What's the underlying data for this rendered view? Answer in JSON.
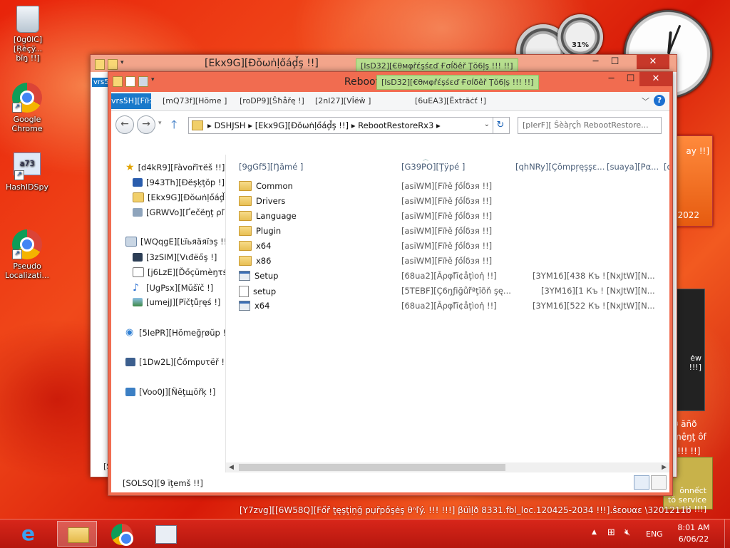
{
  "desktop": {
    "icons": [
      {
        "label": "[0g0lC][Ŗèçÿ..."
      },
      {
        "label": "bĭŋ !!]"
      },
      {
        "label": "Google\nChrome"
      },
      {
        "label": "HashIDSpy"
      },
      {
        "label": "Pseudo\nLocalizati..."
      }
    ],
    "gauge_text": "31%",
    "calendar_text": "ay !!]",
    "calendar_year": "2022",
    "feed_text": "ėw\n!!!]",
    "bg_text_1": "ø ăñð",
    "bg_text_2": "mệŋţ ôf",
    "bg_text_3": "!!! !!]",
    "notification_text": "ŏnnếct\ntŏ service !!! !!!]",
    "watermark": "[Y7zvg][[6W58Q][Főř ţęşţiņğ pџřpőşėş θⁿľý. !!! !!!] βüìļð 8331.fbl_loc.120425-2034 !!!].ŝεουαε \\3201211b"
  },
  "back_window": {
    "title": "[Ekx9G][Ðŏωṅḷőáḑ̌ş !!]",
    "left_tab_fragment": "vrs5",
    "status_fragment": "[S"
  },
  "tooltip_back": "[IsD32][€θмφřέşśεď Ғσĺδêř Ţŏ6ļş !!! !!]",
  "tooltip_front": "[IsD32][€θмφřέşśεď Ғσĺδêř Ţŏ6ļş !!! !!]",
  "window": {
    "title": "RebootRestoreRx3",
    "ribbon": {
      "file_tab": "vrs5H][Fïŀз",
      "tabs": [
        "[mQ73f][Hŏmе ]",
        "[roDP9][Ŝħåřę !]",
        "[2nI27][Vİёŵ ]",
        "[6uEA3][Ëхtrăċť !]"
      ]
    },
    "address": {
      "crumbs": [
        "DSHJSH",
        "[Ekx9G][Ðŏωṅḷőáḑ̌ş !!]",
        "RebootRestoreRx3"
      ]
    },
    "search_placeholder": "[pIerF][ Ŝèàŗçĥ RebootRestore...",
    "nav": {
      "favorites": "[d4kR9][Fàvоřĭτёš !!]",
      "desktop": "[943Th][Ðёşķţŏр !]",
      "downloads": "[Ekx9G][Ðŏωṅḷőáḑ̌ş",
      "recent": "[GRWVo][Ґеčёŋţ ρľ",
      "libraries": "[WQqgE][Ŀïьяäяïэş !!]",
      "videos": "[3zSIM][Vιđёőş !]",
      "documents": "[j6LzE][Ďőçŭmèŋτś !",
      "music": "[UgPsx][Mŭšïč !]",
      "pictures": "[umejJ][Pïčţůŗęś !]",
      "homegroup": "[5IePR][Hŏmеğŗøŭp !!]",
      "computer": "[1Dw2L][Ĉőmрυτёř !]",
      "network": "[Voo0J][Ňĕţщŏřķ !]"
    },
    "columns": [
      "[9gGf5][Ŋămé ]",
      "[G39PO][Ţÿрé ]",
      "[qhNRy][Çŏmрŗęşşε...",
      "[suaya][Pα...",
      "[d"
    ],
    "files": [
      {
        "icon": "folder-icon",
        "name": "Common",
        "type": "[asiWM][Fїŀě ƒőĺδзя !!]",
        "size": "",
        "extra": ""
      },
      {
        "icon": "folder-icon",
        "name": "Drivers",
        "type": "[asiWM][Fїŀě ƒőĺδзя !!]",
        "size": "",
        "extra": ""
      },
      {
        "icon": "folder-icon",
        "name": "Language",
        "type": "[asiWM][Fїŀě ƒőĺδзя !!]",
        "size": "",
        "extra": ""
      },
      {
        "icon": "folder-icon",
        "name": "Plugin",
        "type": "[asiWM][Fїŀě ƒőĺδзя !!]",
        "size": "",
        "extra": ""
      },
      {
        "icon": "folder-icon",
        "name": "x64",
        "type": "[asiWM][Fїŀě ƒőĺδзя !!]",
        "size": "",
        "extra": ""
      },
      {
        "icon": "folder-icon",
        "name": "x86",
        "type": "[asiWM][Fїŀě ƒőĺδзя !!]",
        "size": "",
        "extra": ""
      },
      {
        "icon": "application-icon",
        "name": "Setup",
        "type": "[68ua2][Āρφľ̈ĭ¢åţìοἡ !!]",
        "size": "[3YM16][438 Къ !",
        "extra": "[NxJtW][N..."
      },
      {
        "icon": "config-file-icon",
        "name": "setup",
        "type": "[5TEBF][Ç6ŋƒіğůř̂ªţĭõň şę...",
        "size": "[3YM16][1 Къ !",
        "extra": "[NxJtW][N..."
      },
      {
        "icon": "application-icon",
        "name": "x64",
        "type": "[68ua2][Āρφľ̈ĭ¢åţìοἡ !!]",
        "size": "[3YM16][522 Къ !",
        "extra": "[NxJtW][N..."
      }
    ],
    "status_text": "[SOLSQ][9 ïţеmš !!]"
  },
  "taskbar": {
    "language": "ENG",
    "time": "8:01 AM",
    "date": "6/06/22",
    "accent": "#c81f12"
  }
}
